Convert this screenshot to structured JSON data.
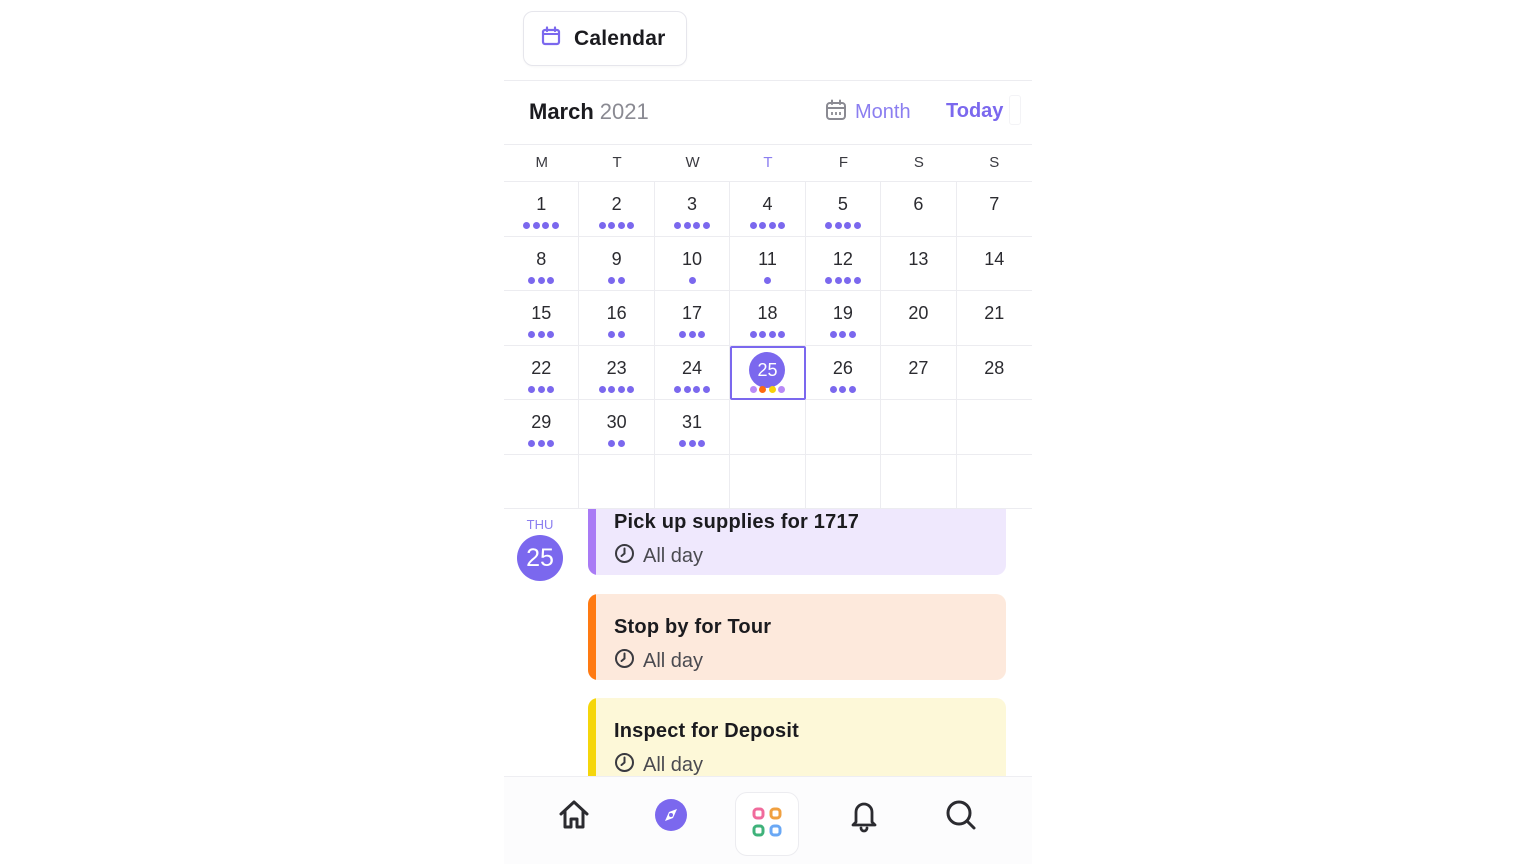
{
  "header": {
    "chip_label": "Calendar",
    "chip_icon": "calendar-icon"
  },
  "month_header": {
    "month": "March",
    "year": "2021",
    "view_label": "Month",
    "view_icon": "calendar-grid-icon",
    "today_label": "Today"
  },
  "weekdays": [
    "M",
    "T",
    "W",
    "T",
    "F",
    "S",
    "S"
  ],
  "active_weekday_index": 3,
  "days": [
    {
      "n": "1",
      "dots": 4
    },
    {
      "n": "2",
      "dots": 4
    },
    {
      "n": "3",
      "dots": 4
    },
    {
      "n": "4",
      "dots": 4
    },
    {
      "n": "5",
      "dots": 4
    },
    {
      "n": "6",
      "dots": 0
    },
    {
      "n": "7",
      "dots": 0
    },
    {
      "n": "8",
      "dots": 3
    },
    {
      "n": "9",
      "dots": 2
    },
    {
      "n": "10",
      "dots": 1
    },
    {
      "n": "11",
      "dots": 1
    },
    {
      "n": "12",
      "dots": 4
    },
    {
      "n": "13",
      "dots": 0
    },
    {
      "n": "14",
      "dots": 0
    },
    {
      "n": "15",
      "dots": 3
    },
    {
      "n": "16",
      "dots": 2
    },
    {
      "n": "17",
      "dots": 3
    },
    {
      "n": "18",
      "dots": 4
    },
    {
      "n": "19",
      "dots": 3
    },
    {
      "n": "20",
      "dots": 0
    },
    {
      "n": "21",
      "dots": 0
    },
    {
      "n": "22",
      "dots": 3
    },
    {
      "n": "23",
      "dots": 4
    },
    {
      "n": "24",
      "dots": 4
    },
    {
      "n": "25",
      "dots": 4,
      "selected": true,
      "dot_colors": [
        "#b98af7",
        "#ff6a10",
        "#f8d20a",
        "#b98af7"
      ]
    },
    {
      "n": "26",
      "dots": 3
    },
    {
      "n": "27",
      "dots": 0
    },
    {
      "n": "28",
      "dots": 0
    },
    {
      "n": "29",
      "dots": 3
    },
    {
      "n": "30",
      "dots": 2
    },
    {
      "n": "31",
      "dots": 3
    },
    {
      "n": "",
      "dots": 0
    },
    {
      "n": "",
      "dots": 0
    },
    {
      "n": "",
      "dots": 0
    },
    {
      "n": "",
      "dots": 0
    },
    {
      "n": "",
      "dots": 0
    },
    {
      "n": "",
      "dots": 0
    },
    {
      "n": "",
      "dots": 0
    },
    {
      "n": "",
      "dots": 0
    },
    {
      "n": "",
      "dots": 0
    },
    {
      "n": "",
      "dots": 0
    },
    {
      "n": "",
      "dots": 0
    }
  ],
  "agenda": {
    "day_of_week": "THU",
    "day_number": "25",
    "events": [
      {
        "title": "Pick up supplies for 1717",
        "time": "All day",
        "color": "#a97bf5"
      },
      {
        "title": "Stop by for Tour",
        "time": "All day",
        "color": "#ff7a12"
      },
      {
        "title": "Inspect for Deposit",
        "time": "All day",
        "color": "#f5d60b"
      }
    ]
  },
  "bottom_nav": {
    "items": [
      "home-icon",
      "explore-icon",
      "apps-icon",
      "bell-icon",
      "search-icon"
    ]
  },
  "colors": {
    "accent": "#7b68ee",
    "dot": "#7b68ee"
  }
}
